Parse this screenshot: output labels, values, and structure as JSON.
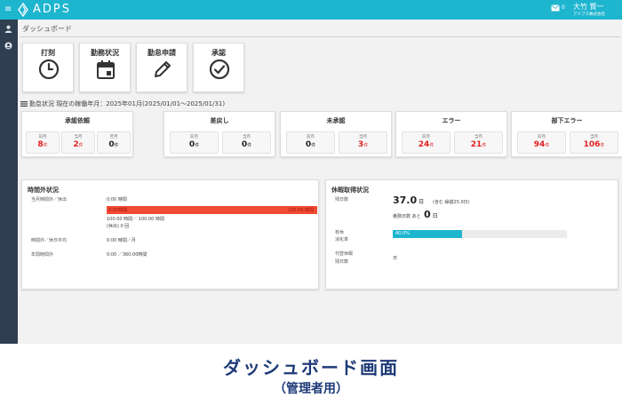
{
  "header": {
    "menu_glyph": "≡",
    "app_name": "ADPS",
    "mail_count": "0",
    "user_name": "大竹 賢一",
    "user_company": "アドプス株式会社"
  },
  "sidebar": {
    "items": [
      {
        "icon": "user-icon"
      },
      {
        "icon": "account-circle-icon"
      }
    ]
  },
  "page": {
    "title": "ダッシュボード"
  },
  "tiles": [
    {
      "label": "打刻",
      "icon": "clock-icon"
    },
    {
      "label": "勤務状況",
      "icon": "calendar-icon"
    },
    {
      "label": "勤怠申請",
      "icon": "pencil-icon"
    },
    {
      "label": "承認",
      "icon": "check-circle-icon"
    }
  ],
  "status": {
    "header": "勤怠状況 現在の稼働年月：2025年01月(2025/01/01～2025/01/31)",
    "unit": "件",
    "cards": [
      {
        "title": "承認依頼",
        "counts": [
          {
            "label": "前月",
            "value": "8",
            "red": true
          },
          {
            "label": "当月",
            "value": "2",
            "red": true
          },
          {
            "label": "翌月",
            "value": "0",
            "red": false
          }
        ]
      },
      {
        "title": "差戻し",
        "counts": [
          {
            "label": "前月",
            "value": "0",
            "red": false
          },
          {
            "label": "当月",
            "value": "0",
            "red": false
          }
        ]
      },
      {
        "title": "未承認",
        "counts": [
          {
            "label": "前月",
            "value": "0",
            "red": false
          },
          {
            "label": "当月",
            "value": "3",
            "red": true
          }
        ]
      },
      {
        "title": "エラー",
        "counts": [
          {
            "label": "前月",
            "value": "24",
            "red": true
          },
          {
            "label": "当月",
            "value": "21",
            "red": true
          }
        ]
      },
      {
        "title": "部下エラー",
        "counts": [
          {
            "label": "前月",
            "value": "94",
            "red": true
          },
          {
            "label": "当月",
            "value": "106",
            "red": true
          }
        ]
      }
    ]
  },
  "overtime": {
    "title": "時間外状況",
    "row1_label": "当月時間外／休出",
    "row1_value": "0:00 時間",
    "bar_left": "0:00時間",
    "bar_right": "100:00 時間",
    "bar_fill": 1.0,
    "bar_color": "#f24a33",
    "row1_detail": "100:00 時間／ 100:00 時間",
    "row1_holiday": "(休出) 0 回",
    "row2_label": "時間外／休日平均",
    "row2_value": "0:00 時間／月",
    "row3_label": "年間時間外",
    "row3_value": "0:00 ／360:00時間"
  },
  "leave": {
    "title": "休暇取得状況",
    "remain_label": "残日数",
    "remain_value": "37.0",
    "remain_unit": "日",
    "remain_note": "(含む 繰越25.0日)",
    "planned_label": "義務日数 あと",
    "planned_value": "0",
    "planned_unit": "日",
    "paid_label_1": "有休",
    "paid_label_2": "消化率",
    "paid_pct_text": "40.0%",
    "paid_pct": 0.4,
    "accent_color": "#1eb5cf",
    "comp_label_1": "代替休暇",
    "comp_label_2": "残日数",
    "comp_value": "日"
  },
  "caption": {
    "title": "ダッシュボード画面",
    "subtitle": "（管理者用）"
  }
}
